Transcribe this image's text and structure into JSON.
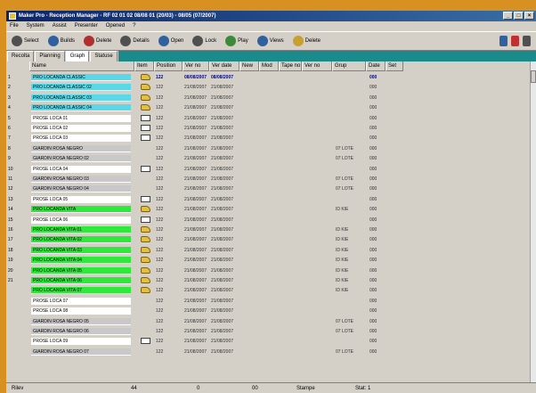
{
  "window": {
    "title": "Maker Pro - Reception Manager - RF 02 01 02 08/08 01 (20/03) - 08/05 (07/2007)"
  },
  "menu": [
    "File",
    "System",
    "Assist",
    "Presenter",
    "Opened",
    "?"
  ],
  "toolbar": {
    "buttons": [
      {
        "label": "Select",
        "icon": "select-icon"
      },
      {
        "label": "Builds",
        "icon": "builds-icon"
      },
      {
        "label": "Delete",
        "icon": "delete-icon"
      },
      {
        "label": "Details",
        "icon": "details-icon"
      },
      {
        "label": "Open",
        "icon": "open-icon"
      },
      {
        "label": "Lock",
        "icon": "lock-icon"
      },
      {
        "label": "Play",
        "icon": "play-icon"
      },
      {
        "label": "Views",
        "icon": "views-icon"
      },
      {
        "label": "Delete",
        "icon": "delete-all-icon"
      }
    ]
  },
  "tabs": [
    "Recolta",
    "Planning",
    "Graph",
    "Statuse"
  ],
  "columns": [
    "Name",
    "Item",
    "Position",
    "Ver no",
    "Ver date",
    "New",
    "Mod",
    "Tape no",
    "Ver no",
    "Grup",
    "Date",
    "Set"
  ],
  "rows": [
    {
      "num": "1",
      "name": "PRO LOCANDA CLASSIC",
      "color": "#5ad8e8",
      "icon": "folder",
      "item": "122",
      "d1": "08/08/2007",
      "d2": "08/08/2007",
      "grp": "",
      "code": "000",
      "sel": true
    },
    {
      "num": "2",
      "name": "PRO LOCANDA CLASSIC 02",
      "color": "#5ad8e8",
      "icon": "folder",
      "item": "122",
      "d1": "21/08/2007",
      "d2": "21/08/2007",
      "grp": "",
      "code": "000",
      "sel": false
    },
    {
      "num": "3",
      "name": "PRO LOCANDA CLASSIC 03",
      "color": "#5ad8e8",
      "icon": "folder",
      "item": "122",
      "d1": "21/08/2007",
      "d2": "21/08/2007",
      "grp": "",
      "code": "000",
      "sel": false
    },
    {
      "num": "4",
      "name": "PRO LOCANDA CLASSIC 04",
      "color": "#5ad8e8",
      "icon": "folder",
      "item": "122",
      "d1": "21/08/2007",
      "d2": "21/08/2007",
      "grp": "",
      "code": "000",
      "sel": false
    },
    {
      "num": "5",
      "name": "PROSE LOCA 01",
      "color": "#ffffff",
      "icon": "doc",
      "item": "122",
      "d1": "21/08/2007",
      "d2": "21/08/2007",
      "grp": "",
      "code": "000",
      "sel": false
    },
    {
      "num": "6",
      "name": "PROSE LOCA 02",
      "color": "#ffffff",
      "icon": "doc",
      "item": "122",
      "d1": "21/08/2007",
      "d2": "21/08/2007",
      "grp": "",
      "code": "000",
      "sel": false
    },
    {
      "num": "7",
      "name": "PROSE LOCA 03",
      "color": "#ffffff",
      "icon": "doc",
      "item": "122",
      "d1": "21/08/2007",
      "d2": "21/08/2007",
      "grp": "",
      "code": "000",
      "sel": false
    },
    {
      "num": "8",
      "name": "GIARDIN ROSA NEGRO",
      "color": "#c8c8c8",
      "icon": "",
      "item": "122",
      "d1": "21/08/2007",
      "d2": "21/08/2007",
      "grp": "07 LOTE",
      "code": "000",
      "sel": false
    },
    {
      "num": "9",
      "name": "GIARDIN ROSA NEGRO 02",
      "color": "#c8c8c8",
      "icon": "",
      "item": "122",
      "d1": "21/08/2007",
      "d2": "21/08/2007",
      "grp": "07 LOTE",
      "code": "000",
      "sel": false
    },
    {
      "num": "10",
      "name": "PROSE LOCA 04",
      "color": "#ffffff",
      "icon": "doc",
      "item": "122",
      "d1": "21/08/2007",
      "d2": "21/08/2007",
      "grp": "",
      "code": "000",
      "sel": false
    },
    {
      "num": "11",
      "name": "GIARDIN ROSA NEGRO 03",
      "color": "#c8c8c8",
      "icon": "",
      "item": "122",
      "d1": "21/08/2007",
      "d2": "21/08/2007",
      "grp": "07 LOTE",
      "code": "000",
      "sel": false
    },
    {
      "num": "12",
      "name": "GIARDIN ROSA NEGRO 04",
      "color": "#c8c8c8",
      "icon": "",
      "item": "122",
      "d1": "21/08/2007",
      "d2": "21/08/2007",
      "grp": "07 LOTE",
      "code": "000",
      "sel": false
    },
    {
      "num": "13",
      "name": "PROSE LOCA 05",
      "color": "#ffffff",
      "icon": "doc",
      "item": "122",
      "d1": "21/08/2007",
      "d2": "21/08/2007",
      "grp": "",
      "code": "000",
      "sel": false
    },
    {
      "num": "14",
      "name": "PRO LOCANDA VITA",
      "color": "#2ee83a",
      "icon": "folder",
      "item": "122",
      "d1": "21/08/2007",
      "d2": "21/08/2007",
      "grp": "ID KIE",
      "code": "000",
      "sel": false
    },
    {
      "num": "15",
      "name": "PROSE LOCA 06",
      "color": "#ffffff",
      "icon": "doc",
      "item": "122",
      "d1": "21/08/2007",
      "d2": "21/08/2007",
      "grp": "",
      "code": "000",
      "sel": false
    },
    {
      "num": "16",
      "name": "PRO LOCANDA VITA 01",
      "color": "#2ee83a",
      "icon": "folder",
      "item": "122",
      "d1": "21/08/2007",
      "d2": "21/08/2007",
      "grp": "ID KIE",
      "code": "000",
      "sel": false
    },
    {
      "num": "17",
      "name": "PRO LOCANDA VITA 02",
      "color": "#2ee83a",
      "icon": "folder",
      "item": "122",
      "d1": "21/08/2007",
      "d2": "21/08/2007",
      "grp": "ID KIE",
      "code": "000",
      "sel": false
    },
    {
      "num": "18",
      "name": "PRO LOCANDA VITA 03",
      "color": "#2ee83a",
      "icon": "folder",
      "item": "122",
      "d1": "21/08/2007",
      "d2": "21/08/2007",
      "grp": "ID KIE",
      "code": "000",
      "sel": false
    },
    {
      "num": "19",
      "name": "PRO LOCANDA VITA 04",
      "color": "#2ee83a",
      "icon": "folder",
      "item": "122",
      "d1": "21/08/2007",
      "d2": "21/08/2007",
      "grp": "ID KIE",
      "code": "000",
      "sel": false
    },
    {
      "num": "20",
      "name": "PRO LOCANDA VITA 05",
      "color": "#2ee83a",
      "icon": "folder",
      "item": "122",
      "d1": "21/08/2007",
      "d2": "21/08/2007",
      "grp": "ID KIE",
      "code": "000",
      "sel": false
    },
    {
      "num": "21",
      "name": "PRO LOCANDA VITA 06",
      "color": "#2ee83a",
      "icon": "folder",
      "item": "122",
      "d1": "21/08/2007",
      "d2": "21/08/2007",
      "grp": "ID KIE",
      "code": "000",
      "sel": false
    },
    {
      "num": "",
      "name": "PRO LOCANDA VITA 07",
      "color": "#2ee83a",
      "icon": "folder",
      "item": "122",
      "d1": "21/08/2007",
      "d2": "21/08/2007",
      "grp": "ID KIE",
      "code": "000",
      "sel": false
    },
    {
      "num": "",
      "name": "PROSE LOCA 07",
      "color": "#ffffff",
      "icon": "",
      "item": "122",
      "d1": "21/08/2007",
      "d2": "21/08/2007",
      "grp": "",
      "code": "000",
      "sel": false
    },
    {
      "num": "",
      "name": "PROSE LOCA 08",
      "color": "#ffffff",
      "icon": "",
      "item": "122",
      "d1": "21/08/2007",
      "d2": "21/08/2007",
      "grp": "",
      "code": "000",
      "sel": false
    },
    {
      "num": "",
      "name": "GIARDIN ROSA NEGRO 05",
      "color": "#c8c8c8",
      "icon": "",
      "item": "122",
      "d1": "21/08/2007",
      "d2": "21/08/2007",
      "grp": "07 LOTE",
      "code": "000",
      "sel": false
    },
    {
      "num": "",
      "name": "GIARDIN ROSA NEGRO 06",
      "color": "#c8c8c8",
      "icon": "",
      "item": "122",
      "d1": "21/08/2007",
      "d2": "21/08/2007",
      "grp": "07 LOTE",
      "code": "000",
      "sel": false
    },
    {
      "num": "",
      "name": "PROSE LOCA 09",
      "color": "#ffffff",
      "icon": "doc",
      "item": "122",
      "d1": "21/08/2007",
      "d2": "21/08/2007",
      "grp": "",
      "code": "000",
      "sel": false
    },
    {
      "num": "",
      "name": "GIARDIN ROSA NEGRO 07",
      "color": "#c8c8c8",
      "icon": "",
      "item": "122",
      "d1": "21/08/2007",
      "d2": "21/08/2007",
      "grp": "07 LOTE",
      "code": "000",
      "sel": false
    }
  ],
  "status": {
    "label1": "Rilev",
    "count": "44",
    "label2": "0",
    "label3": "00",
    "label4": "Stampe",
    "label5": "Stat: 1"
  }
}
